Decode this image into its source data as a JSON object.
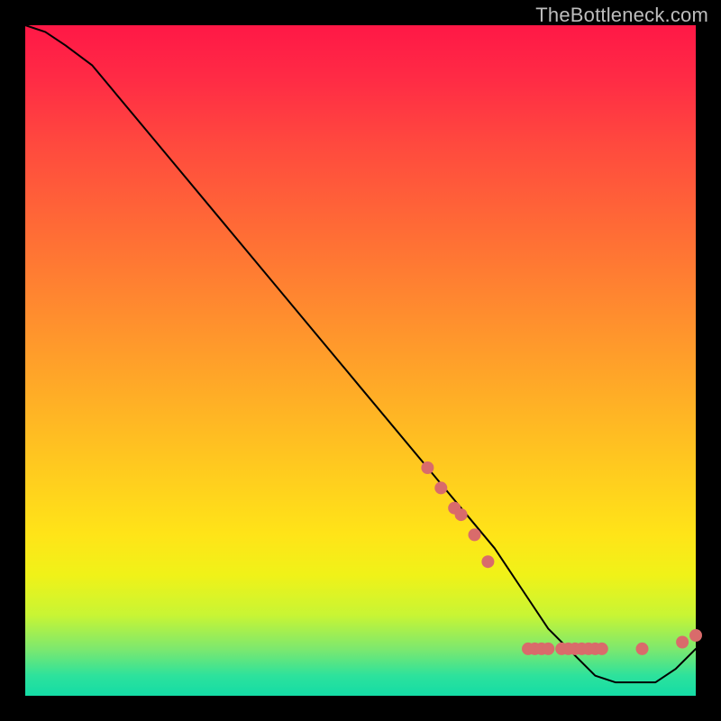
{
  "watermark": "TheBottleneck.com",
  "chart_data": {
    "type": "line",
    "title": "",
    "xlabel": "",
    "ylabel": "",
    "xlim": [
      0,
      100
    ],
    "ylim": [
      0,
      100
    ],
    "grid": false,
    "legend": false,
    "background_gradient": {
      "direction": "vertical",
      "stops": [
        {
          "pos": 0,
          "color": "#ff1846"
        },
        {
          "pos": 50,
          "color": "#ffaa27"
        },
        {
          "pos": 80,
          "color": "#f0f218"
        },
        {
          "pos": 100,
          "color": "#14dca6"
        }
      ]
    },
    "series": [
      {
        "name": "bottleneck-curve",
        "x": [
          0,
          3,
          6,
          10,
          20,
          30,
          40,
          50,
          60,
          65,
          70,
          74,
          78,
          82,
          85,
          88,
          91,
          94,
          97,
          100
        ],
        "y": [
          100,
          99,
          97,
          94,
          82,
          70,
          58,
          46,
          34,
          28,
          22,
          16,
          10,
          6,
          3,
          2,
          2,
          2,
          4,
          7
        ]
      }
    ],
    "markers": {
      "name": "highlighted-points",
      "color": "#d96b6b",
      "points": [
        {
          "x": 60,
          "y": 34
        },
        {
          "x": 62,
          "y": 31
        },
        {
          "x": 64,
          "y": 28
        },
        {
          "x": 65,
          "y": 27
        },
        {
          "x": 67,
          "y": 24
        },
        {
          "x": 69,
          "y": 20
        },
        {
          "x": 75,
          "y": 7
        },
        {
          "x": 76,
          "y": 7
        },
        {
          "x": 77,
          "y": 7
        },
        {
          "x": 78,
          "y": 7
        },
        {
          "x": 80,
          "y": 7
        },
        {
          "x": 81,
          "y": 7
        },
        {
          "x": 82,
          "y": 7
        },
        {
          "x": 83,
          "y": 7
        },
        {
          "x": 84,
          "y": 7
        },
        {
          "x": 85,
          "y": 7
        },
        {
          "x": 86,
          "y": 7
        },
        {
          "x": 92,
          "y": 7
        },
        {
          "x": 98,
          "y": 8
        },
        {
          "x": 100,
          "y": 9
        }
      ]
    }
  }
}
